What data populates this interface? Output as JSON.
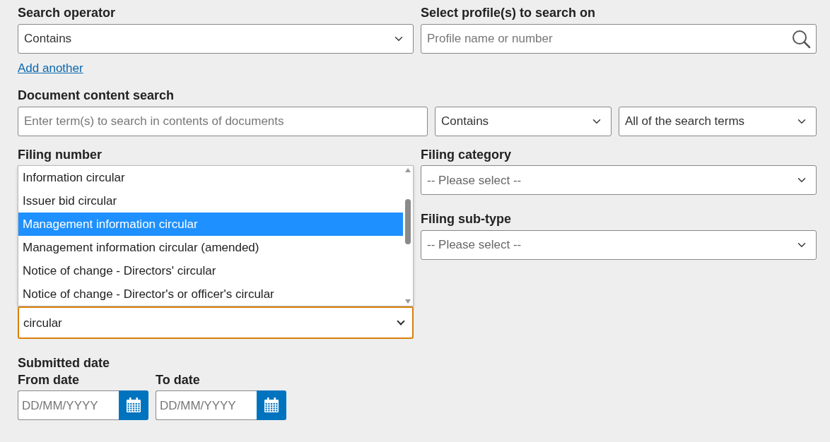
{
  "search_operator": {
    "label": "Search operator",
    "value": "Contains"
  },
  "profiles": {
    "label": "Select profile(s) to search on",
    "placeholder": "Profile name or number"
  },
  "add_another": "Add another",
  "content_search": {
    "label": "Document content search",
    "placeholder": "Enter term(s) to search in contents of documents",
    "operator": "Contains",
    "match": "All of the search terms"
  },
  "filing_number": {
    "label": "Filing number"
  },
  "filing_type": {
    "value": "circular",
    "options": [
      {
        "label": "Information circular",
        "selected": false
      },
      {
        "label": "Issuer bid circular",
        "selected": false
      },
      {
        "label": "Management information circular",
        "selected": true
      },
      {
        "label": "Management information circular (amended)",
        "selected": false
      },
      {
        "label": "Notice of change - Directors' circular",
        "selected": false
      },
      {
        "label": "Notice of change - Director's or officer's circular",
        "selected": false
      }
    ]
  },
  "filing_category": {
    "label": "Filing category",
    "value": "-- Please select --"
  },
  "filing_sub_type": {
    "label": "Filing sub-type",
    "value": "-- Please select --"
  },
  "submitted_date": {
    "label": "Submitted date",
    "from": {
      "label": "From date",
      "placeholder": "DD/MM/YYYY"
    },
    "to": {
      "label": "To date",
      "placeholder": "DD/MM/YYYY"
    }
  }
}
